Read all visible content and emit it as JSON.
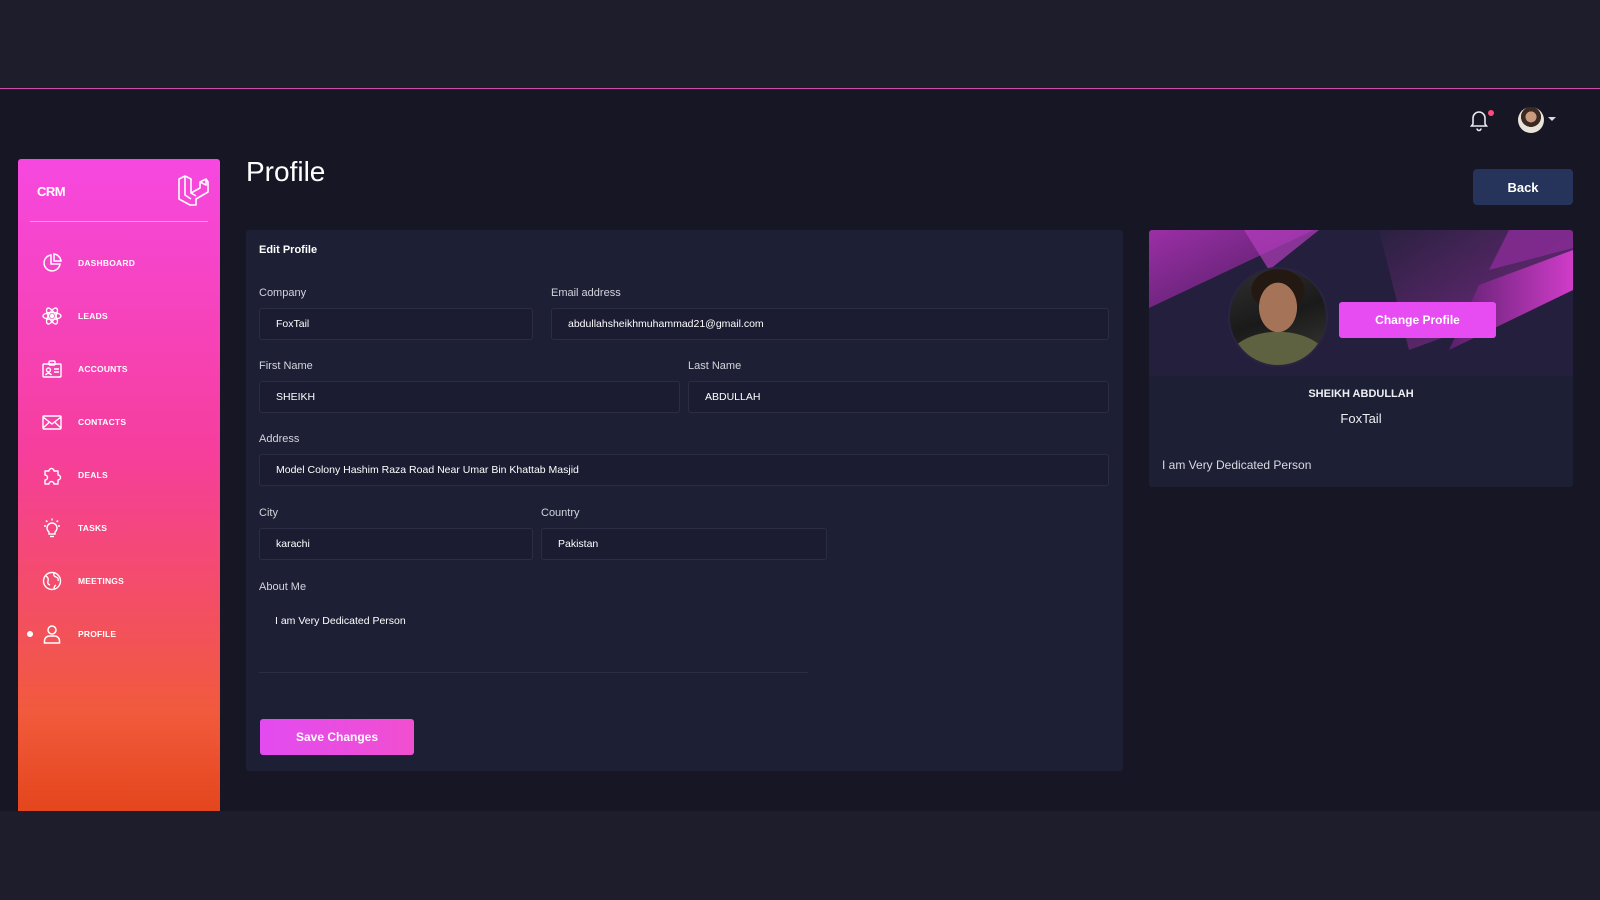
{
  "sidebar": {
    "brand": "CRM",
    "items": [
      {
        "label": "DASHBOARD",
        "icon": "pie-chart-icon"
      },
      {
        "label": "LEADS",
        "icon": "atom-icon"
      },
      {
        "label": "ACCOUNTS",
        "icon": "id-card-icon"
      },
      {
        "label": "CONTACTS",
        "icon": "envelope-icon"
      },
      {
        "label": "DEALS",
        "icon": "puzzle-icon"
      },
      {
        "label": "TASKS",
        "icon": "lightbulb-icon"
      },
      {
        "label": "MEETINGS",
        "icon": "globe-icon"
      },
      {
        "label": "PROFILE",
        "icon": "user-icon",
        "active": true
      }
    ]
  },
  "header": {
    "notification_icon": "bell-icon",
    "avatar_icon": "user-avatar"
  },
  "page": {
    "title": "Profile",
    "back_label": "Back"
  },
  "edit_profile": {
    "title": "Edit Profile",
    "company_label": "Company",
    "company_value": "FoxTail",
    "email_label": "Email address",
    "email_value": "abdullahsheikhmuhammad21@gmail.com",
    "first_name_label": "First Name",
    "first_name_value": "SHEIKH",
    "last_name_label": "Last Name",
    "last_name_value": "ABDULLAH",
    "address_label": "Address",
    "address_value": "Model Colony Hashim Raza Road Near Umar Bin Khattab Masjid",
    "city_label": "City",
    "city_value": "karachi",
    "country_label": "Country",
    "country_value": "Pakistan",
    "about_label": "About Me",
    "about_value": "I am Very Dedicated Person",
    "save_label": "Save Changes"
  },
  "profile_card": {
    "change_label": "Change Profile",
    "name": "SHEIKH ABDULLAH",
    "company": "FoxTail",
    "about": "I am Very Dedicated Person"
  },
  "colors": {
    "accent": "#e74bf2",
    "sidebar_top": "#f648e0",
    "sidebar_bottom": "#e4461d",
    "card_bg": "#1d1f35",
    "back_button": "#26345b"
  }
}
